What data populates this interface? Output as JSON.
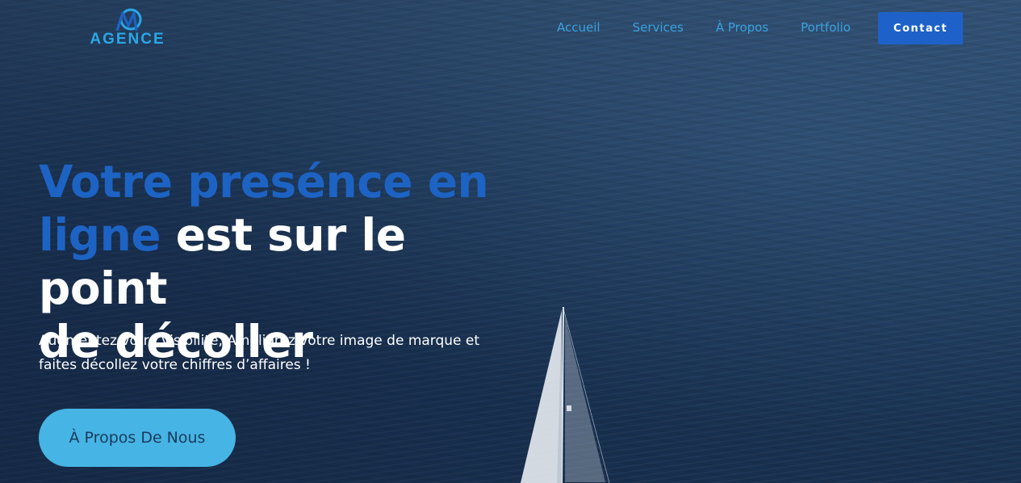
{
  "brand": {
    "logo_text": "AGENCE",
    "accent_color": "#1d63c4",
    "light_accent": "#46b4e4"
  },
  "nav": {
    "items": [
      {
        "label": "Accueil"
      },
      {
        "label": "Services"
      },
      {
        "label": "À Propos"
      },
      {
        "label": "Portfolio"
      }
    ],
    "contact_label": "Contact"
  },
  "hero": {
    "headline_accent_1": "Votre presénce en",
    "headline_accent_2": "ligne",
    "headline_rest_1": " est sur le point",
    "headline_rest_2": "de décoller",
    "subtitle": "Augmentez votre visibilité, Améliorez votre image de marque et faites décollez votre chiffres d’affaires !",
    "cta_label": "À Propos De Nous"
  }
}
